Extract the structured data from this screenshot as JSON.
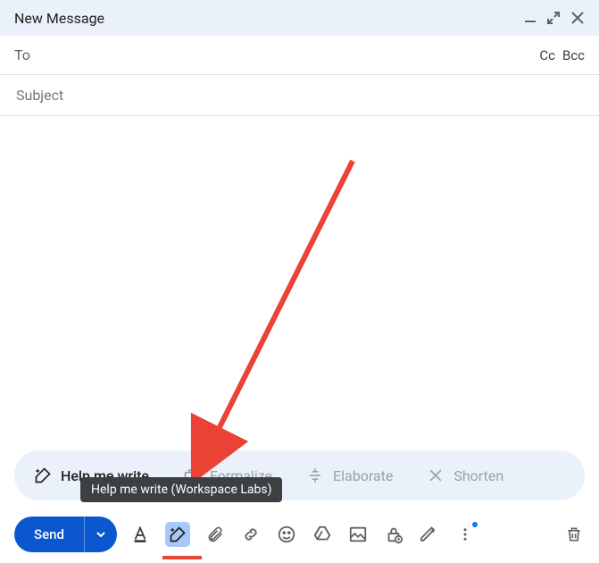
{
  "header": {
    "title": "New Message"
  },
  "recipients": {
    "to_label": "To",
    "cc_label": "Cc",
    "bcc_label": "Bcc"
  },
  "subject": {
    "placeholder": "Subject"
  },
  "suggestions": {
    "help": "Help me write",
    "formalize": "Formalize",
    "elaborate": "Elaborate",
    "shorten": "Shorten"
  },
  "tooltip": {
    "text": "Help me write (Workspace Labs)"
  },
  "toolbar": {
    "send_label": "Send"
  }
}
